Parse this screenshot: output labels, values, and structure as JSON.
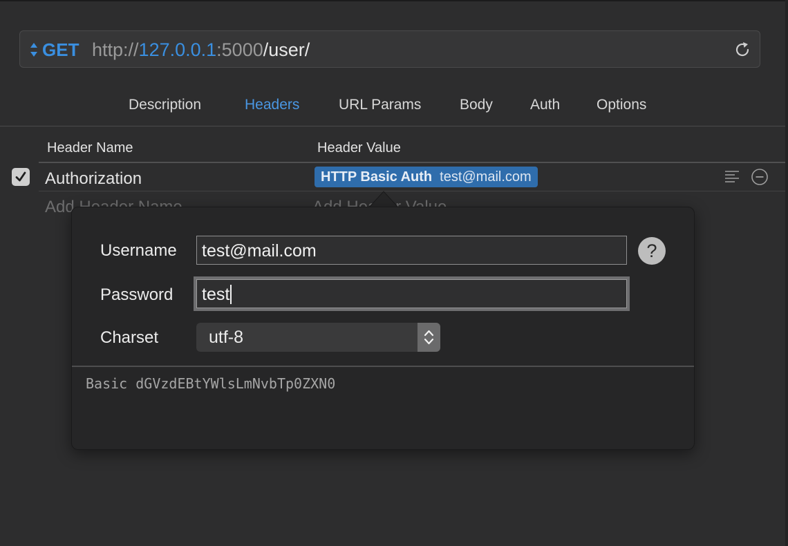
{
  "request": {
    "method": "GET",
    "url": {
      "scheme": "http://",
      "host": "127.0.0.1",
      "port": ":5000",
      "path": "/user/"
    }
  },
  "tabs": [
    {
      "label": "Description"
    },
    {
      "label": "Headers"
    },
    {
      "label": "URL Params"
    },
    {
      "label": "Body"
    },
    {
      "label": "Auth"
    },
    {
      "label": "Options"
    }
  ],
  "active_tab": "Headers",
  "headers_table": {
    "columns": [
      "Header Name",
      "Header Value"
    ],
    "rows": [
      {
        "enabled": true,
        "name": "Authorization",
        "value_token": {
          "type": "HTTP Basic Auth",
          "user": "test@mail.com"
        }
      }
    ],
    "placeholders": {
      "name": "Add Header Name",
      "value": "Add Header Value"
    }
  },
  "auth_popover": {
    "username_label": "Username",
    "username_value": "test@mail.com",
    "password_label": "Password",
    "password_value": "test",
    "charset_label": "Charset",
    "charset_value": "utf-8",
    "help_symbol": "?",
    "result": "Basic dGVzdEBtYWlsLmNvbTp0ZXN0"
  },
  "colors": {
    "accent": "#3a8fe0",
    "token_bg": "#2f6dac",
    "background": "#2d2d2e"
  }
}
